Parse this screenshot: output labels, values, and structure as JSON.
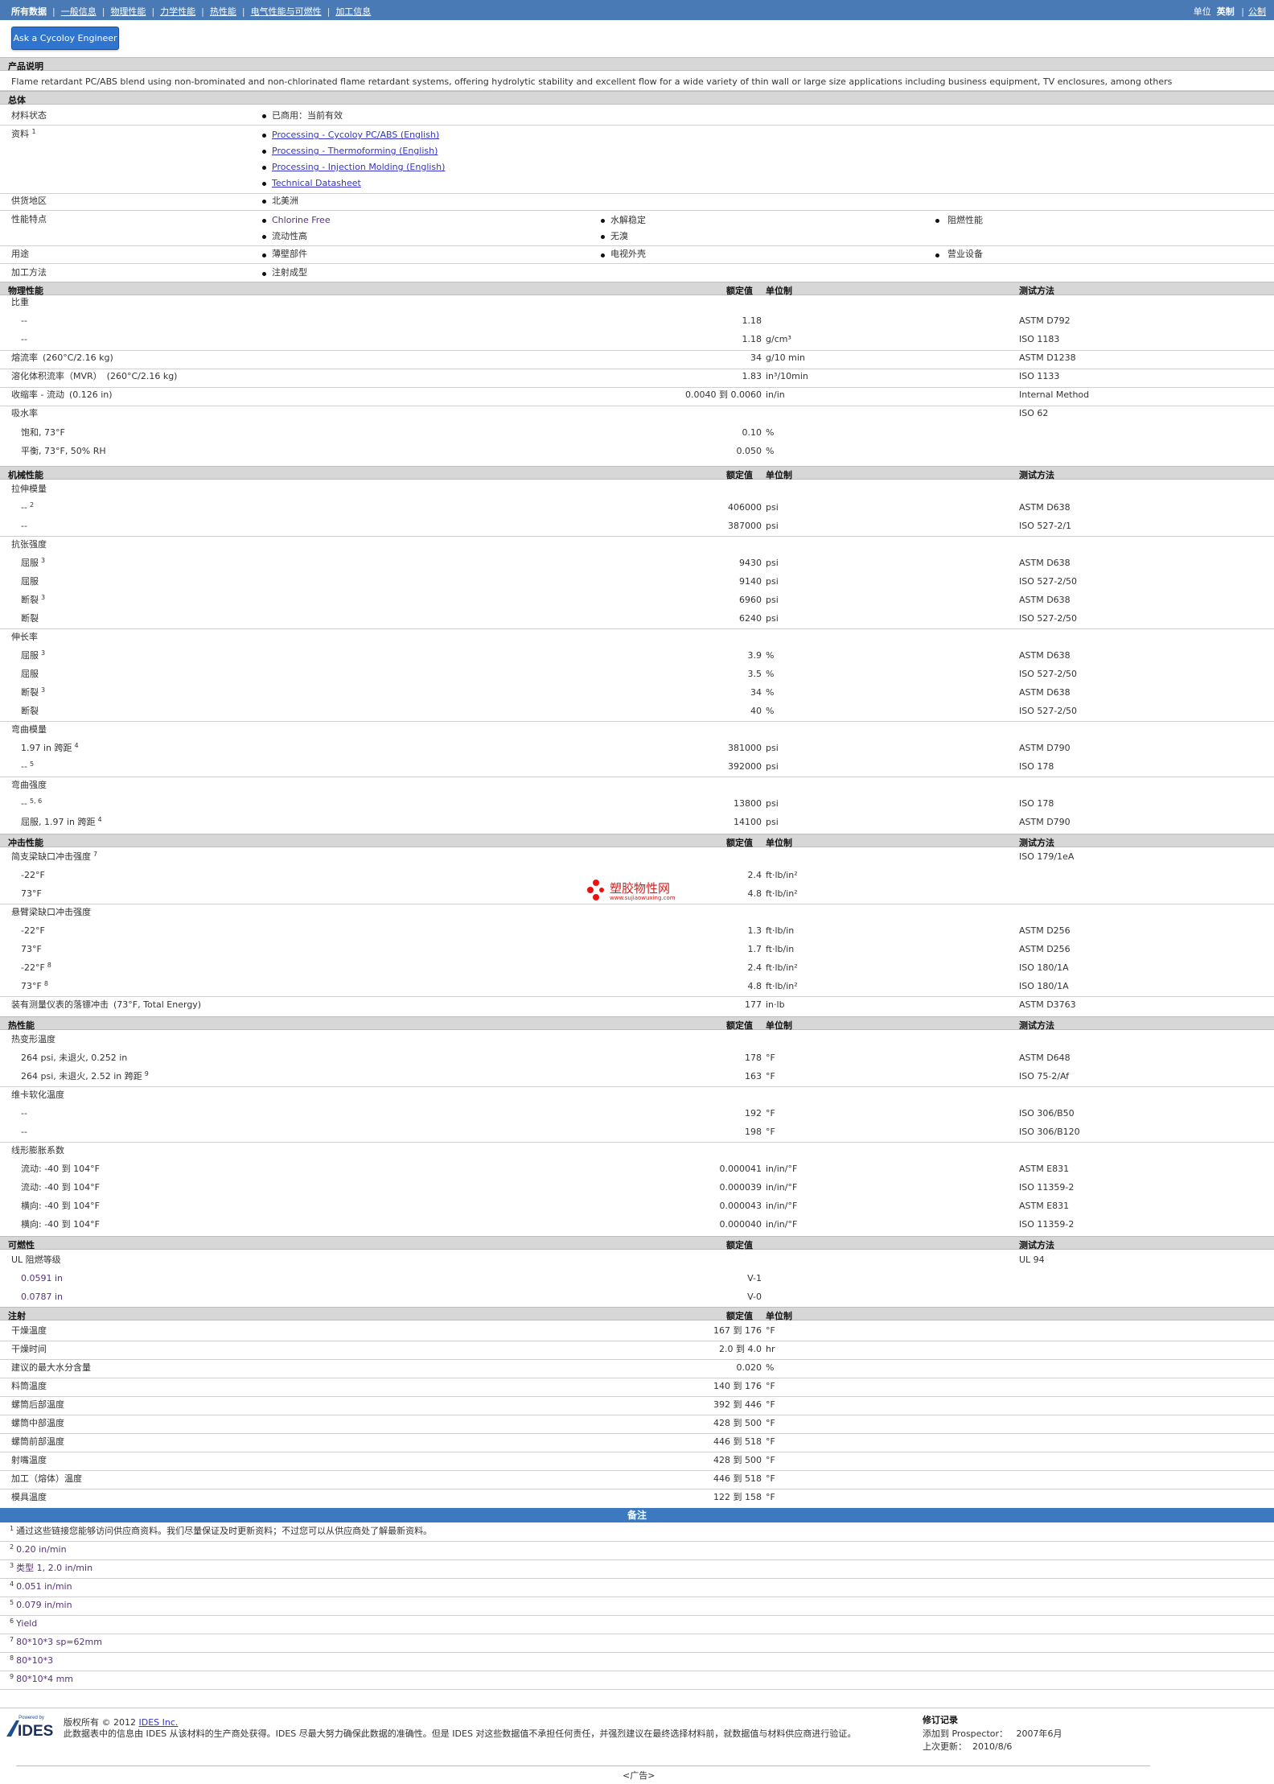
{
  "tabs": {
    "items": [
      "所有数据",
      "一般信息",
      "物理性能",
      "力学性能",
      "热性能",
      "电气性能与可燃性",
      "加工信息"
    ],
    "units_label": "单位",
    "units_active": "英制",
    "units_other": "公制"
  },
  "ask_button": "Ask a Cycoloy Engineer",
  "description": {
    "title": "产品说明",
    "text": "Flame retardant PC/ABS blend using non-brominated and non-chlorinated flame retardant systems, offering hydrolytic stability and excellent flow for a wide variety of thin wall or large size applications including business equipment, TV enclosures, among others"
  },
  "general": {
    "title": "总体",
    "material_status_label": "材料状态",
    "material_status": "已商用：当前有效",
    "docs_label": "资料",
    "docs_sup": "1",
    "docs": [
      "Processing - Cycoloy PC/ABS (English)",
      "Processing - Thermoforming (English)",
      "Processing - Injection Molding (English)",
      "Technical Datasheet"
    ],
    "region_label": "供货地区",
    "region": "北美洲",
    "features_label": "性能特点",
    "features": [
      "Chlorine Free",
      "水解稳定",
      "阻燃性能",
      "流动性高",
      "无溴"
    ],
    "uses_label": "用途",
    "uses": [
      "薄壁部件",
      "电视外壳",
      "营业设备"
    ],
    "process_label": "加工方法",
    "process": "注射成型"
  },
  "headers": {
    "nominal": "额定值",
    "unit": "单位制",
    "method": "测试方法"
  },
  "physical": {
    "title": "物理性能",
    "rows": [
      {
        "a": "比重",
        "b": "",
        "v": "",
        "u": "",
        "m": ""
      },
      {
        "a": "--",
        "b": "",
        "v": "1.18",
        "u": "",
        "m": "ASTM D792"
      },
      {
        "a": "--",
        "b": "",
        "v": "1.18",
        "u": "g/cm³",
        "m": "ISO 1183"
      },
      {
        "a": "熔流率",
        "b": "(260°C/2.16 kg)",
        "v": "34",
        "u": "g/10 min",
        "m": "ASTM D1238"
      },
      {
        "a": "溶化体积流率（MVR）",
        "b": "(260°C/2.16 kg)",
        "v": "1.83",
        "u": "in³/10min",
        "m": "ISO 1133"
      },
      {
        "a": "收缩率 - 流动",
        "b": "(0.126 in)",
        "v": "0.0040 到 0.0060",
        "u": "in/in",
        "m": "Internal Method"
      },
      {
        "a": "吸水率",
        "b": "",
        "v": "",
        "u": "",
        "m": "ISO 62"
      },
      {
        "a": "饱和, 73°F",
        "b": "",
        "v": "0.10",
        "u": "%",
        "m": ""
      },
      {
        "a": "平衡, 73°F, 50% RH",
        "b": "",
        "v": "0.050",
        "u": "%",
        "m": ""
      }
    ]
  },
  "mechanical": {
    "title": "机械性能",
    "rows": [
      {
        "a": "拉伸模量",
        "s": "",
        "v": "",
        "u": "",
        "m": ""
      },
      {
        "a": "--",
        "s": "2",
        "v": "406000",
        "u": "psi",
        "m": "ASTM D638"
      },
      {
        "a": "--",
        "s": "",
        "v": "387000",
        "u": "psi",
        "m": "ISO 527-2/1"
      },
      {
        "a": "抗张强度",
        "s": "",
        "v": "",
        "u": "",
        "m": ""
      },
      {
        "a": "屈服",
        "s": "3",
        "v": "9430",
        "u": "psi",
        "m": "ASTM D638"
      },
      {
        "a": "屈服",
        "s": "",
        "v": "9140",
        "u": "psi",
        "m": "ISO 527-2/50"
      },
      {
        "a": "断裂",
        "s": "3",
        "v": "6960",
        "u": "psi",
        "m": "ASTM D638"
      },
      {
        "a": "断裂",
        "s": "",
        "v": "6240",
        "u": "psi",
        "m": "ISO 527-2/50"
      },
      {
        "a": "伸长率",
        "s": "",
        "v": "",
        "u": "",
        "m": ""
      },
      {
        "a": "屈服",
        "s": "3",
        "v": "3.9",
        "u": "%",
        "m": "ASTM D638"
      },
      {
        "a": "屈服",
        "s": "",
        "v": "3.5",
        "u": "%",
        "m": "ISO 527-2/50"
      },
      {
        "a": "断裂",
        "s": "3",
        "v": "34",
        "u": "%",
        "m": "ASTM D638"
      },
      {
        "a": "断裂",
        "s": "",
        "v": "40",
        "u": "%",
        "m": "ISO 527-2/50"
      },
      {
        "a": "弯曲模量",
        "s": "",
        "v": "",
        "u": "",
        "m": ""
      },
      {
        "a": "1.97 in 跨距",
        "s": "4",
        "v": "381000",
        "u": "psi",
        "m": "ASTM D790"
      },
      {
        "a": "--",
        "s": "5",
        "v": "392000",
        "u": "psi",
        "m": "ISO 178"
      },
      {
        "a": "弯曲强度",
        "s": "",
        "v": "",
        "u": "",
        "m": ""
      },
      {
        "a": "--",
        "s": "5, 6",
        "v": "13800",
        "u": "psi",
        "m": "ISO 178"
      },
      {
        "a": "屈服, 1.97 in 跨距",
        "s": "4",
        "v": "14100",
        "u": "psi",
        "m": "ASTM D790"
      }
    ]
  },
  "impact": {
    "title": "冲击性能",
    "rows": [
      {
        "a": "简支梁缺口冲击强度",
        "s": "7",
        "v": "",
        "u": "",
        "m": "ISO 179/1eA"
      },
      {
        "a": "-22°F",
        "s": "",
        "v": "2.4",
        "u": "ft·lb/in²",
        "m": ""
      },
      {
        "a": "73°F",
        "s": "",
        "v": "4.8",
        "u": "ft·lb/in²",
        "m": ""
      },
      {
        "a": "悬臂梁缺口冲击强度",
        "s": "",
        "v": "",
        "u": "",
        "m": ""
      },
      {
        "a": "-22°F",
        "s": "",
        "v": "1.3",
        "u": "ft·lb/in",
        "m": "ASTM D256"
      },
      {
        "a": "73°F",
        "s": "",
        "v": "1.7",
        "u": "ft·lb/in",
        "m": "ASTM D256"
      },
      {
        "a": "-22°F",
        "s": "8",
        "v": "2.4",
        "u": "ft·lb/in²",
        "m": "ISO 180/1A"
      },
      {
        "a": "73°F",
        "s": "8",
        "v": "4.8",
        "u": "ft·lb/in²",
        "m": "ISO 180/1A"
      },
      {
        "a": "装有测量仪表的落镖冲击",
        "s": "",
        "b": "(73°F, Total Energy)",
        "v": "177",
        "u": "in·lb",
        "m": "ASTM D3763"
      }
    ]
  },
  "watermark": {
    "cn": "塑胶物性网",
    "en": "www.sujiaowuxing.com"
  },
  "thermal": {
    "title": "热性能",
    "rows": [
      {
        "a": "热变形温度",
        "s": "",
        "v": "",
        "u": "",
        "m": ""
      },
      {
        "a": "264 psi, 未退火, 0.252 in",
        "s": "",
        "v": "178",
        "u": "°F",
        "m": "ASTM D648"
      },
      {
        "a": "264 psi, 未退火, 2.52 in 跨距",
        "s": "9",
        "v": "163",
        "u": "°F",
        "m": "ISO 75-2/Af"
      },
      {
        "a": "维卡软化温度",
        "s": "",
        "v": "",
        "u": "",
        "m": ""
      },
      {
        "a": "--",
        "s": "",
        "v": "192",
        "u": "°F",
        "m": "ISO 306/B50"
      },
      {
        "a": "--",
        "s": "",
        "v": "198",
        "u": "°F",
        "m": "ISO 306/B120"
      },
      {
        "a": "线形膨胀系数",
        "s": "",
        "v": "",
        "u": "",
        "m": ""
      },
      {
        "a": "流动: -40 到 104°F",
        "s": "",
        "v": "0.000041",
        "u": "in/in/°F",
        "m": "ASTM E831"
      },
      {
        "a": "流动: -40 到 104°F",
        "s": "",
        "v": "0.000039",
        "u": "in/in/°F",
        "m": "ISO 11359-2"
      },
      {
        "a": "横向: -40 到 104°F",
        "s": "",
        "v": "0.000043",
        "u": "in/in/°F",
        "m": "ASTM E831"
      },
      {
        "a": "横向: -40 到 104°F",
        "s": "",
        "v": "0.000040",
        "u": "in/in/°F",
        "m": "ISO 11359-2"
      }
    ]
  },
  "flammability": {
    "title": "可燃性",
    "rows": [
      {
        "a": "UL 阻燃等级",
        "v": "",
        "m": "UL 94"
      },
      {
        "a": "0.0591 in",
        "v": "V-1",
        "m": ""
      },
      {
        "a": "0.0787 in",
        "v": "V-0",
        "m": ""
      }
    ]
  },
  "injection": {
    "title": "注射",
    "rows": [
      {
        "a": "干燥温度",
        "v": "167 到 176",
        "u": "°F"
      },
      {
        "a": "干燥时间",
        "v": "2.0 到 4.0",
        "u": "hr"
      },
      {
        "a": "建议的最大水分含量",
        "v": "0.020",
        "u": "%"
      },
      {
        "a": "料筒温度",
        "v": "140 到 176",
        "u": "°F"
      },
      {
        "a": "螺筒后部温度",
        "v": "392 到 446",
        "u": "°F"
      },
      {
        "a": "螺筒中部温度",
        "v": "428 到 500",
        "u": "°F"
      },
      {
        "a": "螺筒前部温度",
        "v": "446 到 518",
        "u": "°F"
      },
      {
        "a": "射嘴温度",
        "v": "428 到 500",
        "u": "°F"
      },
      {
        "a": "加工（熔体）温度",
        "v": "446 到 518",
        "u": "°F"
      },
      {
        "a": "模具温度",
        "v": "122 到 158",
        "u": "°F"
      }
    ]
  },
  "notes": {
    "title": "备注",
    "items": [
      {
        "n": "1",
        "t": "通过这些链接您能够访问供应商资料。我们尽量保证及时更新资料；不过您可以从供应商处了解最新资料。"
      },
      {
        "n": "2",
        "t": "0.20 in/min"
      },
      {
        "n": "3",
        "t": "类型  1, 2.0 in/min"
      },
      {
        "n": "4",
        "t": "0.051 in/min"
      },
      {
        "n": "5",
        "t": "0.079 in/min"
      },
      {
        "n": "6",
        "t": "Yield"
      },
      {
        "n": "7",
        "t": "80*10*3 sp=62mm"
      },
      {
        "n": "8",
        "t": "80*10*3"
      },
      {
        "n": "9",
        "t": "80*10*4 mm"
      }
    ]
  },
  "footer": {
    "logo_small": "Powered by",
    "logo": "IDES",
    "copyright_prefix": "版权所有 © 2012",
    "copyright_link": "IDES Inc.",
    "disclaimer": "此数据表中的信息由 IDES 从该材料的生产商处获得。IDES 尽最大努力确保此数据的准确性。但是 IDES 对这些数据值不承担任何责任，并强烈建议在最终选择材料前，就数据值与材料供应商进行验证。",
    "rev_title": "修订记录",
    "added_label": "添加到 Prospector：",
    "added_date": "2007年6月",
    "updated_label": "上次更新：",
    "updated_date": "2010/8/6",
    "ad": "<广告>"
  }
}
